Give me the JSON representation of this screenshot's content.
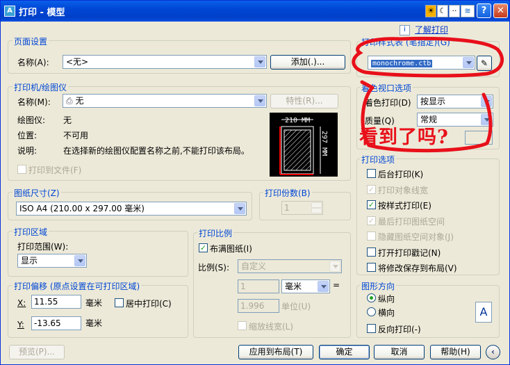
{
  "window": {
    "title": "打印 - 模型",
    "app_icon": "A",
    "tool_icons": [
      "sun-icon",
      "moon-icon",
      "dots-icon",
      "wave-icon"
    ],
    "help_btn": "?",
    "close_btn": "✕"
  },
  "top_link": {
    "info": "i",
    "text": "了解打印"
  },
  "page_setup": {
    "group_label": "页面设置",
    "name_label": "名称(A):",
    "name_value": "<无>",
    "add_button": "添加(.)..."
  },
  "printer": {
    "group_label": "打印机/绘图仪",
    "name_label": "名称(M):",
    "name_value": "无",
    "properties_button": "特性(R)...",
    "plotter_label": "绘图仪:",
    "plotter_value": "无",
    "location_label": "位置:",
    "location_value": "不可用",
    "desc_label": "说明:",
    "desc_value": "在选择新的绘图仪配置名称之前,不能打印该布局。",
    "print_to_file": "打印到文件(F)",
    "preview_width": "210 MM",
    "preview_height": "297 MM"
  },
  "paper_size": {
    "group_label": "图纸尺寸(Z)",
    "value": "ISO A4 (210.00 x 297.00 毫米)"
  },
  "copies": {
    "group_label": "打印份数(B)",
    "value": "1"
  },
  "print_area": {
    "group_label": "打印区域",
    "range_label": "打印范围(W):",
    "range_value": "显示"
  },
  "offset": {
    "group_label": "打印偏移 (原点设置在可打印区域)",
    "x_label": "X:",
    "x_value": "11.55",
    "x_unit": "毫米",
    "center_label": "居中打印(C)",
    "y_label": "Y:",
    "y_value": "-13.65",
    "y_unit": "毫米"
  },
  "scale": {
    "group_label": "打印比例",
    "fit_label": "布满图纸(I)",
    "ratio_label": "比例(S):",
    "ratio_value": "自定义",
    "val1": "1",
    "unit1": "毫米",
    "eq": "=",
    "val2": "1.996",
    "unit2": "单位(U)",
    "lineweight_label": "缩放线宽(L)"
  },
  "style_table": {
    "group_label": "打印样式表 (笔指定)(G)",
    "value": "monochrome.ctb"
  },
  "shaded": {
    "group_label": "着色视口选项",
    "shade_label": "着色打印(D)",
    "shade_value": "按显示",
    "quality_label": "质量(Q)",
    "quality_value": "常规"
  },
  "options": {
    "group_label": "打印选项",
    "items": [
      {
        "label": "后台打印(K)",
        "checked": false,
        "disabled": false
      },
      {
        "label": "打印对象线宽",
        "checked": true,
        "disabled": true
      },
      {
        "label": "按样式打印(E)",
        "checked": true,
        "disabled": false
      },
      {
        "label": "最后打印图纸空间",
        "checked": true,
        "disabled": true
      },
      {
        "label": "隐藏图纸空间对象(J)",
        "checked": false,
        "disabled": true
      },
      {
        "label": "打开打印戳记(N)",
        "checked": false,
        "disabled": false
      },
      {
        "label": "将修改保存到布局(V)",
        "checked": false,
        "disabled": false
      }
    ]
  },
  "orientation": {
    "group_label": "图形方向",
    "portrait": "纵向",
    "landscape": "横向",
    "reverse": "反向打印(-)",
    "icon_letter": "A"
  },
  "buttons": {
    "preview": "预览(P)...",
    "apply": "应用到布局(T)",
    "ok": "确定",
    "cancel": "取消",
    "help": "帮助(H)"
  },
  "annotation": {
    "text": "看到了吗?",
    "color": "#e8101a"
  }
}
